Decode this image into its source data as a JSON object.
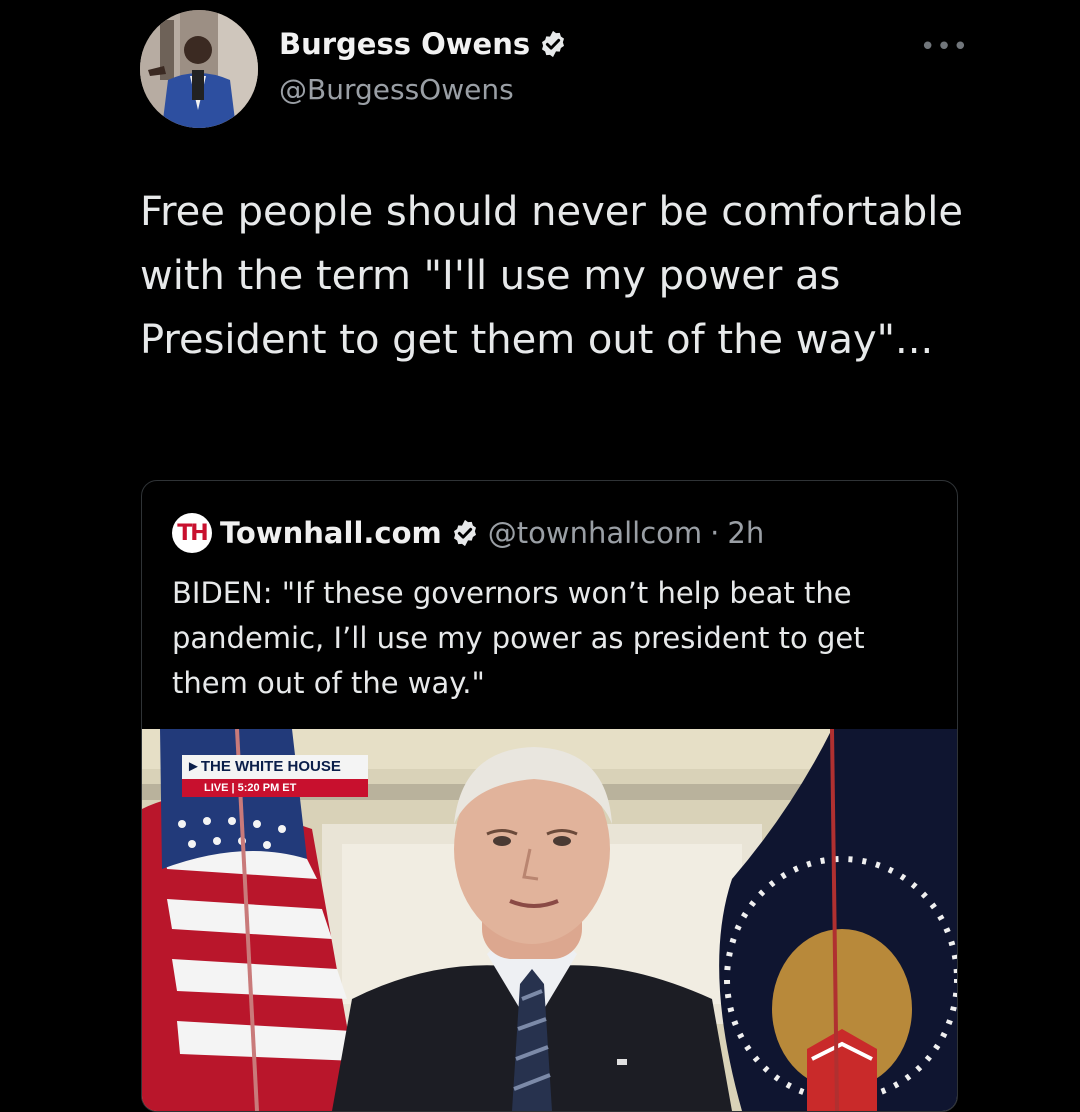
{
  "author": {
    "name": "Burgess Owens",
    "handle": "@BurgessOwens",
    "verified": true,
    "avatar_icon": "profile-photo"
  },
  "more_label": "•••",
  "tweet": {
    "text": "Free people should never be comfortable with the term \"I'll use my power as President to get them out of the way\"..."
  },
  "quoted_tweet": {
    "logo_text": "TH",
    "name": "Townhall.com",
    "handle": "@townhallcom",
    "separator": "·",
    "time": "2h",
    "verified": true,
    "text": "BIDEN: \"If these governors won’t help beat the pandemic, I’ll use my power as president to get them out of the way.\"",
    "media": {
      "chyron_title": "THE WHITE HOUSE",
      "chyron_live": "LIVE",
      "chyron_time": "5:20 PM ET"
    }
  },
  "colors": {
    "background": "#000000",
    "verified_badge": "#e7e9ea",
    "handle_text": "#9a9fa5",
    "border": "#2f3336"
  }
}
